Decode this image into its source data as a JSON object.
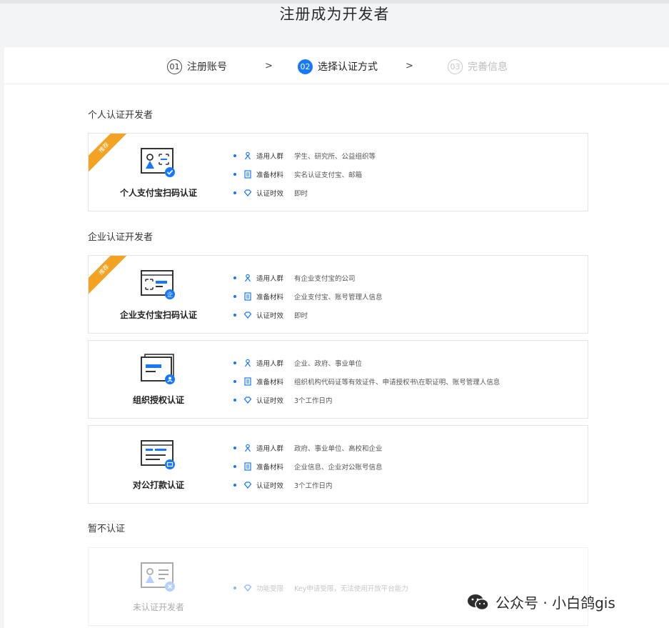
{
  "page_title": "注册成为开发者",
  "steps": [
    {
      "num": "01",
      "label": "注册账号"
    },
    {
      "num": "02",
      "label": "选择认证方式"
    },
    {
      "num": "03",
      "label": "完善信息"
    }
  ],
  "step_separator": ">",
  "sections": {
    "personal": "个人认证开发者",
    "enterprise": "企业认证开发者",
    "none": "暂不认证"
  },
  "ribbon_label": "推荐",
  "attr_keys": {
    "audience": "适用人群",
    "materials": "准备材料",
    "validity": "认证时效",
    "function": "功能受限"
  },
  "cards": [
    {
      "name": "个人支付宝扫码认证",
      "audience": "学生、研究所、公益组织等",
      "materials": "实名认证支付宝、邮箱",
      "validity": "即时"
    },
    {
      "name": "企业支付宝扫码认证",
      "audience": "有企业支付宝的公司",
      "materials": "企业支付宝、账号管理人信息",
      "validity": "即时"
    },
    {
      "name": "组织授权认证",
      "audience": "企业、政府、事业单位",
      "materials": "组织机构代码证等有效证件、申请授权书\\在职证明、账号管理人信息",
      "validity": "3个工作日内"
    },
    {
      "name": "对公打款认证",
      "audience": "政府、事业单位、高校和企业",
      "materials": "企业信息、企业对公账号信息",
      "validity": "3个工作日内"
    },
    {
      "name": "未认证开发者",
      "function": "Key申请受限，无法使用开放平台能力"
    }
  ],
  "watermark": "公众号 · 小白鸽gis",
  "colors": {
    "accent": "#1677ff",
    "ribbon": "#f2a324"
  }
}
